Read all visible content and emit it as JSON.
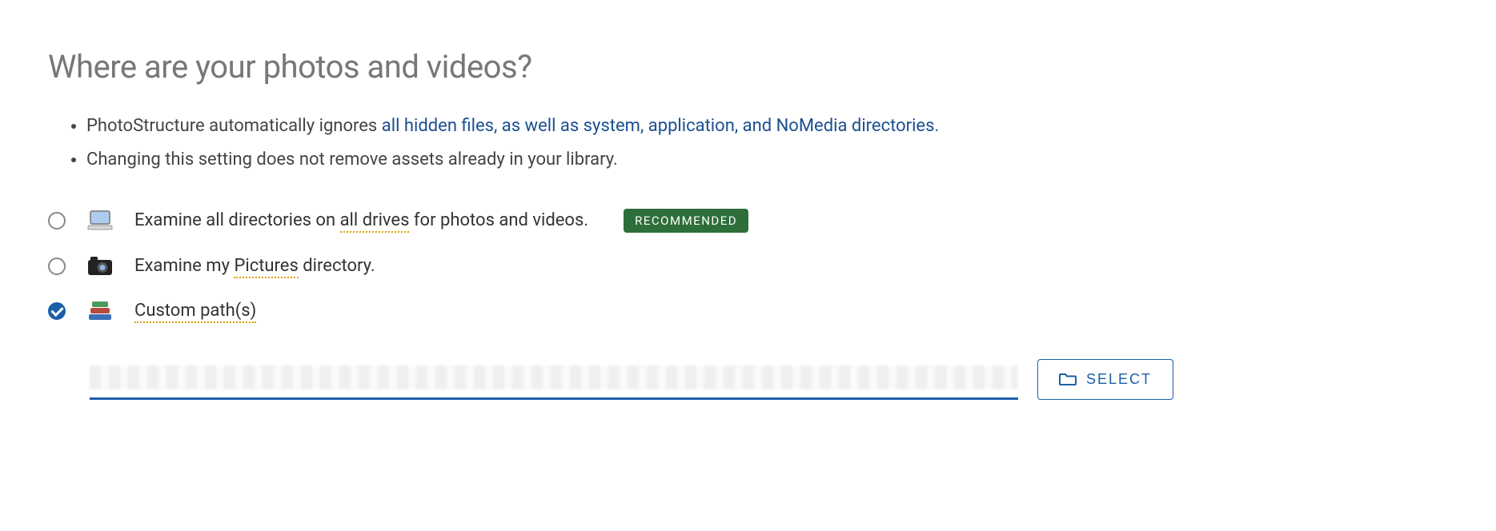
{
  "heading": "Where are your photos and videos?",
  "info": {
    "bullet1_prefix": "PhotoStructure automatically ignores ",
    "bullet1_link": "all hidden files, as well as system, application, and NoMedia directories.",
    "bullet2": "Changing this setting does not remove assets already in your library."
  },
  "options": {
    "opt1_prefix": "Examine all directories on ",
    "opt1_dotted": "all drives",
    "opt1_suffix": " for photos and videos.",
    "opt2_prefix": "Examine my ",
    "opt2_dotted": "Pictures",
    "opt2_suffix": " directory.",
    "opt3": "Custom path(s)",
    "recommended_label": "RECOMMENDED"
  },
  "select_button": "SELECT",
  "selected": "custom",
  "colors": {
    "accent": "#1b5fa7",
    "badge_bg": "#2e6e3a"
  }
}
